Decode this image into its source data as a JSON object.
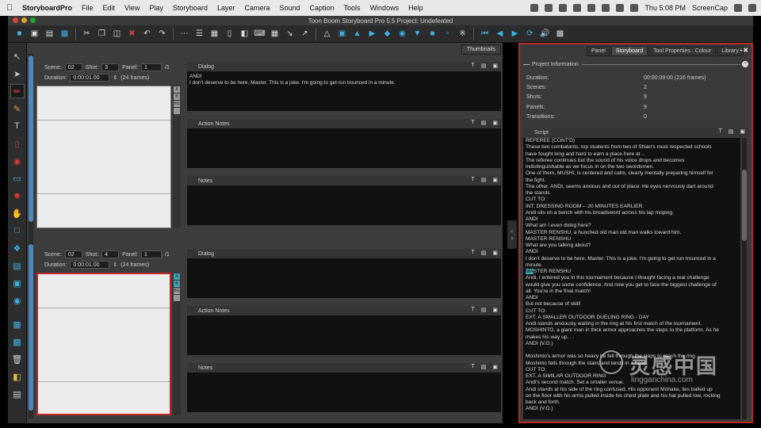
{
  "menubar": {
    "app": "StoryboardPro",
    "items": [
      "File",
      "Edit",
      "View",
      "Play",
      "Storyboard",
      "Layer",
      "Camera",
      "Sound",
      "Caption",
      "Tools",
      "Windows",
      "Help"
    ],
    "clock": "Thu 5:08 PM",
    "user": "ScreenCap"
  },
  "window": {
    "title": "Toon Boom Storyboard Pro 5.5 Project: Undefeated"
  },
  "views": {
    "thumbnails_tab": "Thumbnails"
  },
  "panels": [
    {
      "scene_label": "Scene:",
      "scene": "02",
      "shot_label": "Shot:",
      "shot": "3",
      "panel_label": "Panel:",
      "panel": "1",
      "panel_total": "/1",
      "duration_label": "Duration:",
      "duration": "0:00:01.00",
      "frames": "(24 frames)",
      "dialog_label": "Dialog",
      "dialog_text": "ANDI\nI don't deserve to be here, Master. This is a joke. I'm going to get run trounced in a minute.",
      "action_label": "Action Notes",
      "notes_label": "Notes"
    },
    {
      "scene_label": "Scene:",
      "scene": "02",
      "shot_label": "Shot:",
      "shot": "4",
      "panel_label": "Panel:",
      "panel": "1",
      "panel_total": "/1",
      "duration_label": "Duration:",
      "duration": "0:00:01.00",
      "frames": "(24 frames)",
      "dialog_label": "Dialog",
      "dialog_text": "",
      "action_label": "Action Notes",
      "notes_label": "Notes"
    }
  ],
  "right_panel": {
    "tabs": [
      "Panel",
      "Storyboard",
      "Tool Properties : Colour",
      "Library"
    ],
    "active_tab": "Storyboard",
    "project_info": {
      "title": "Project Information",
      "rows": [
        {
          "label": "Duration:",
          "value": "00:00:09:00  (216 frames)"
        },
        {
          "label": "Scenes:",
          "value": "2"
        },
        {
          "label": "Shots:",
          "value": "9"
        },
        {
          "label": "Panels:",
          "value": "9"
        },
        {
          "label": "Transitions:",
          "value": "0"
        }
      ]
    },
    "script": {
      "title": "Script",
      "lines": [
        "REFEREE (CONT'D)",
        "These two combatants, top students from two of Shian's most respected schools",
        "have fought long and hard to earn a place here at ..",
        "The referee continues but the sound of his voice drops and becomes",
        "indistinguishable as we focus in on the two swordsmen.",
        "One of them, MUSHI, is centered and calm, clearly mentally preparing himself for",
        "the fight.",
        "The other, ANDI, seems anxious and out of place. He eyes nervously dart around",
        "the stands.",
        "CUT TO:",
        "INT. DRESSING ROOM -- 20 MINUTES EARLIER.",
        "Andi sits on a bench with his broadsword across his lap moping.",
        "ANDI",
        "What am I even doing here?",
        "MASTER RENSHU, a hunched old man old man walks toward him.",
        "MASTER RENSHU",
        "What are you talking about?",
        "ANDI",
        "I don't deserve to be here, Master. This is a joke. I'm going to get run trounced in a",
        "minute.",
        "MASTER RENSHU",
        "Andi, I entered you in this tournament because I thought facing a real challenge",
        "would give you some confidence. And now you get to face the biggest challenge of",
        "all. You're in the final match!",
        "ANDI",
        "But not because of skill!",
        "CUT TO:",
        "EXT. A SMALLER OUTDOOR DUELING RING - DAY",
        "Andi stands anxiously waiting in the ring at his first match of the tournament.",
        "MOSHINTO, a giant man in thick armor approaches the steps to the platform. As he",
        "makes his way up. . .",
        "ANDI (V.O.)",
        "",
        "Moshinto's armor was so heavy he fell through the steps to reach the ring.",
        "Moshinto falls through the stairs and lands in a heap.",
        "CUT TO:",
        "EXT. A SIMILAR OUTDOOR RING",
        "Andi's second match. Set a smaller venue.",
        "Andi stands at his side of the ring confused. His opponent Mohake, lies balled up",
        "on the floor with his arms pulled inside his chest plate and his hat pulled low, rocking",
        "back and forth.",
        "ANDI (V.O.)"
      ],
      "highlight_line_index": 20,
      "highlight_text": "MA"
    }
  },
  "watermark": {
    "cn": "灵感中国",
    "en": "lingganchina.com"
  }
}
